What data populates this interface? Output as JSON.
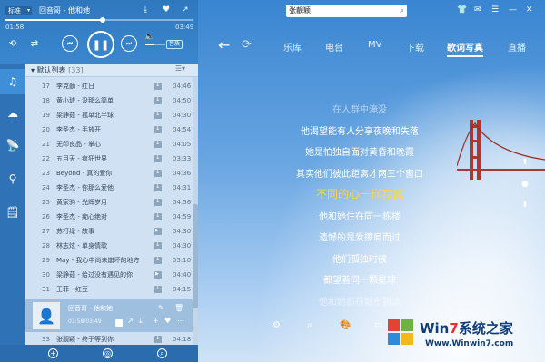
{
  "player": {
    "quality": "标准",
    "now_title": "回音哥 - 他和她",
    "elapsed": "01:58",
    "total": "03:49",
    "progress_fraction": 0.52,
    "volume_fraction": 0.45,
    "quality_badge": "音质"
  },
  "playlist": {
    "title": "▾ 默认列表",
    "count": "[33]",
    "rows": [
      {
        "n": "17",
        "t": "李克勤 - 红日",
        "d": "04:46"
      },
      {
        "n": "18",
        "t": "黄小琥 - 没那么简单",
        "d": "04:50"
      },
      {
        "n": "19",
        "t": "梁静茹 - 孤单北半球",
        "d": "04:30"
      },
      {
        "n": "20",
        "t": "李圣杰 - 手放开",
        "d": "04:54"
      },
      {
        "n": "21",
        "t": "无印良品 - 掌心",
        "d": "04:05"
      },
      {
        "n": "22",
        "t": "五月天 - 疯狂世界",
        "d": "03:33"
      },
      {
        "n": "23",
        "t": "Beyond - 真的爱你",
        "d": "04:36"
      },
      {
        "n": "24",
        "t": "李圣杰 - 你那么爱他",
        "d": "04:31"
      },
      {
        "n": "25",
        "t": "黄家驹 - 光辉岁月",
        "d": "04:56"
      },
      {
        "n": "26",
        "t": "李圣杰 - 痴心绝对",
        "d": "04:59"
      },
      {
        "n": "27",
        "t": "苏打绿 - 故事",
        "d": "04:30"
      },
      {
        "n": "28",
        "t": "林志炫 - 单身情歌",
        "d": "04:30"
      },
      {
        "n": "29",
        "t": "May - 我心中尚未崩坏的地方",
        "d": "05:10"
      },
      {
        "n": "30",
        "t": "梁静茹 - 给过没有遇见的你",
        "d": "04:40"
      },
      {
        "n": "31",
        "t": "王菲 - 红豆",
        "d": "04:15"
      }
    ],
    "now_playing": {
      "title": "回音哥 - 他和她",
      "time": "01:58/03:49"
    },
    "last_row": {
      "n": "33",
      "t": "张靓颖 - 终于等到你",
      "d": "04:18"
    }
  },
  "search": {
    "value": "张靓颖"
  },
  "tabs": [
    "乐库",
    "电台",
    "MV",
    "下载",
    "歌词写真",
    "直播"
  ],
  "active_tab": 4,
  "lyrics": [
    {
      "text": "在人群中淹没",
      "style": "dim"
    },
    {
      "text": "他渴望能有人分享夜晚和失落",
      "style": "normal"
    },
    {
      "text": "她是怕独自面对黄昏和晚霞",
      "style": "normal"
    },
    {
      "text": "其实他们彼此距离才两三个窗口",
      "style": "normal"
    },
    {
      "text": "不同的心一样寂寞",
      "style": "active"
    },
    {
      "text": "他和她住在同一栋楼",
      "style": "normal"
    },
    {
      "text": "遗憾的是爱擦肩而过",
      "style": "normal"
    },
    {
      "text": "他们孤独时候",
      "style": "normal"
    },
    {
      "text": "都望着同一颗星球",
      "style": "normal"
    },
    {
      "text": "他和她都在城市飘流",
      "style": "dim"
    }
  ],
  "watermark": {
    "brand": "Win7系统之家",
    "brand_win": "Win",
    "brand_7": "7",
    "brand_rest": "系统之家",
    "url": "Www.Winwin7.com"
  },
  "colors": {
    "accent": "#3a86c9",
    "lyric_active": "#ffd54a"
  }
}
